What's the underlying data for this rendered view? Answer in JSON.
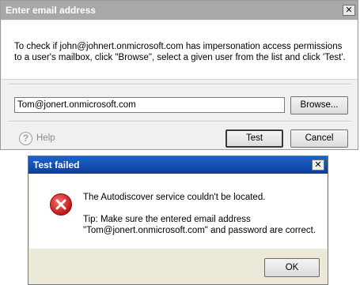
{
  "email_dialog": {
    "title": "Enter email address",
    "close_glyph": "✕",
    "description": "To check if john@johnert.onmicrosoft.com has impersonation access permissions to a user's mailbox, click \"Browse\", select a given user from the list and click 'Test'.",
    "email_value": "Tom@jonert.onmicrosoft.com",
    "browse_label": "Browse...",
    "help_glyph": "?",
    "help_label": "Help",
    "test_label": "Test",
    "cancel_label": "Cancel"
  },
  "error_dialog": {
    "title": "Test failed",
    "close_glyph": "✕",
    "message": "The Autodiscover service couldn't be located.",
    "tip": "Tip: Make sure the entered email address \"Tom@jonert.onmicrosoft.com\" and password are correct.",
    "ok_label": "OK",
    "icon": "error-icon",
    "icon_color": "#d42020"
  }
}
